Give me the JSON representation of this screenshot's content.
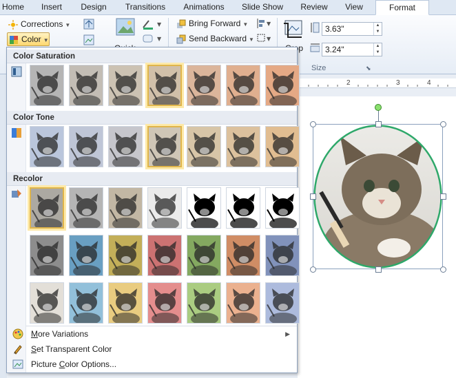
{
  "tabs": [
    "Home",
    "Insert",
    "Design",
    "Transitions",
    "Animations",
    "Slide Show",
    "Review",
    "View",
    "Format"
  ],
  "active_tab": "Format",
  "ribbon": {
    "corrections_label": "Corrections",
    "color_label": "Color",
    "quick_label": "Quick",
    "bring_forward_label": "Bring Forward",
    "send_backward_label": "Send Backward",
    "crop_label": "Crop",
    "height_value": "3.63\"",
    "width_value": "3.24\"",
    "size_group_label": "Size"
  },
  "ruler": {
    "ticks": [
      "2",
      "3",
      "4"
    ]
  },
  "dropdown": {
    "sections": [
      {
        "title": "Color Saturation",
        "thumbs": 7,
        "selected": 3
      },
      {
        "title": "Color Tone",
        "thumbs": 7,
        "selected": 3
      },
      {
        "title": "Recolor",
        "thumbs": 21,
        "selected": 0
      }
    ],
    "menu": [
      {
        "label_pre": "",
        "label_u": "M",
        "label_post": "ore Variations",
        "submenu": true
      },
      {
        "label_pre": "",
        "label_u": "S",
        "label_post": "et Transparent Color",
        "submenu": false
      },
      {
        "label_pre": "Picture ",
        "label_u": "C",
        "label_post": "olor Options...",
        "submenu": false
      }
    ]
  },
  "colors": {
    "accent_selected": "#e0b54a",
    "picture_border": "#2ea86a"
  }
}
